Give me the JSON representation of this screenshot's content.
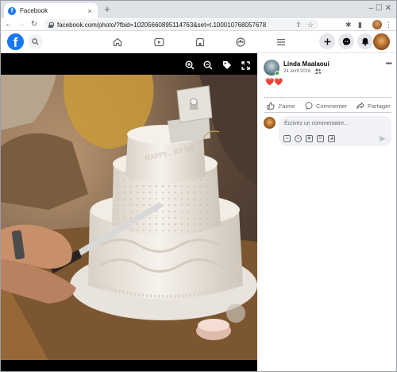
{
  "browser": {
    "tab_title": "Facebook",
    "tab_close": "×",
    "new_tab": "+",
    "window_controls": "‒ ☐ ✕",
    "url": "facebook.com/photo/?fbid=10205660895114763&set=t.100010768057678",
    "nav": {
      "back": "←",
      "forward": "→",
      "reload": "↻"
    }
  },
  "facebook_nav": {
    "logo": "f",
    "icons": [
      "search-icon",
      "home-icon",
      "watch-icon",
      "marketplace-icon",
      "groups-icon",
      "menu-icon",
      "create-icon",
      "messenger-icon",
      "notifications-icon"
    ]
  },
  "post": {
    "author": "Linda Maalaoui",
    "date": "24 avril 2016",
    "reactions": "❤️❤️",
    "actions": {
      "like": "J'aime",
      "comment": "Commenter",
      "share": "Partager"
    },
    "comment_placeholder": "Écrivez un commentaire...",
    "cake_inscription": "HAPPY... RY ME"
  },
  "colors": {
    "facebook_blue": "#1877f2",
    "icon_grey": "#65676b",
    "heart_red": "#e41e3f",
    "online_green": "#31a24c",
    "viewer_bg": "#000000"
  }
}
